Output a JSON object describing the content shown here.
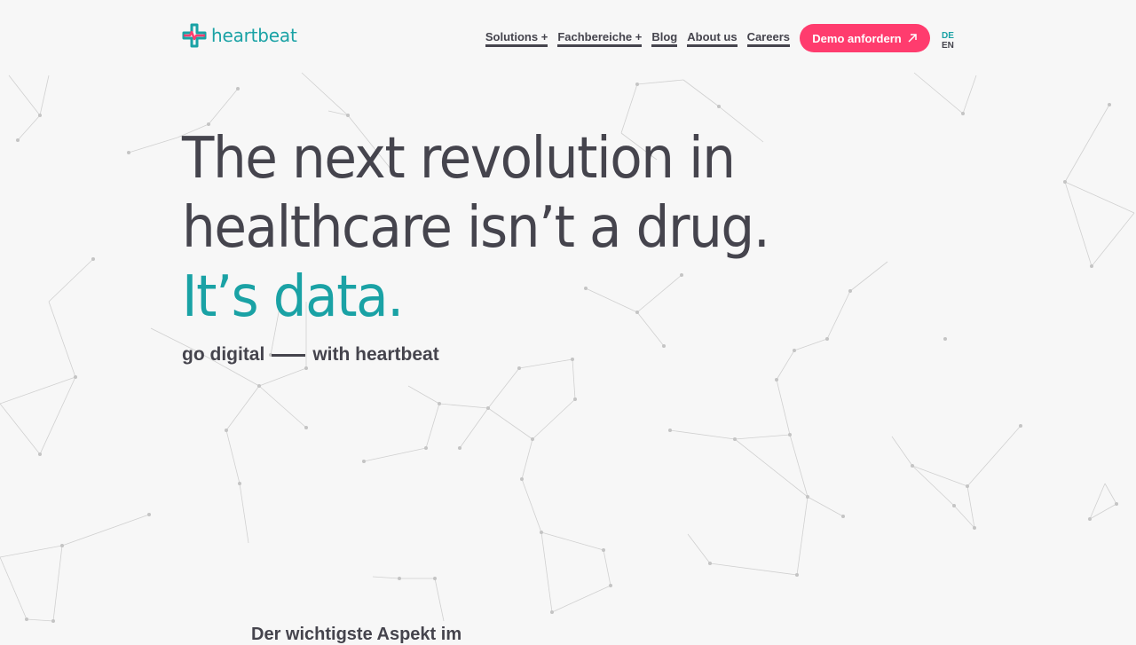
{
  "brand": {
    "name": "heartbeat",
    "accent": "#1aa2a5",
    "cta_color": "#ff3c6e",
    "text_color": "#45444d"
  },
  "nav": {
    "items": [
      {
        "label": "Solutions +"
      },
      {
        "label": "Fachbereiche +"
      },
      {
        "label": "Blog"
      },
      {
        "label": "About us"
      },
      {
        "label": "Careers"
      }
    ],
    "cta": {
      "label": "Demo anfordern",
      "icon": "arrow-up-right-icon"
    },
    "languages": [
      "DE",
      "EN"
    ]
  },
  "hero": {
    "line1": "The next revolution in",
    "line2": "healthcare isn’t a drug.",
    "line3": "It’s data.",
    "tagline_start": "go digital",
    "tagline_end": "with heartbeat"
  },
  "next_section": {
    "heading_peek": "Der wichtigste Aspekt im"
  }
}
